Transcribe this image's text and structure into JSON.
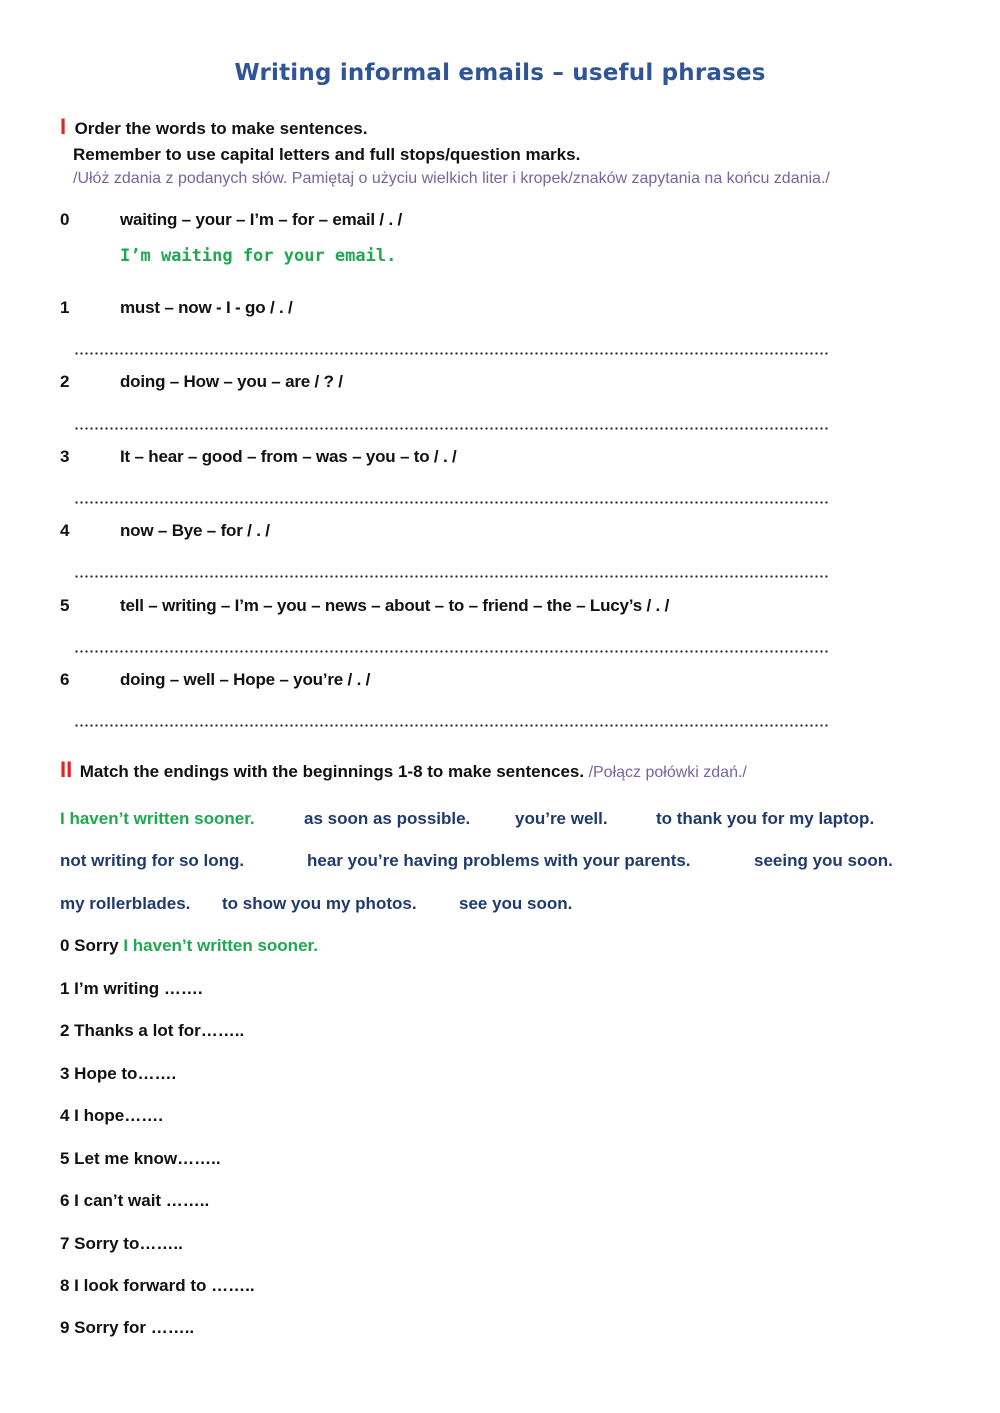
{
  "title": "Writing informal emails – useful phrases",
  "colors": {
    "title": "#2f5597",
    "section_number": "#e8211c",
    "polish_text": "#7a63a0",
    "answer_green": "#1fa84f",
    "ending_blue": "#1f3a6e"
  },
  "section1": {
    "number": "I",
    "instruction_line1": "Order the words to make sentences.",
    "instruction_line2": "Remember to use capital letters and full stops/question marks.",
    "polish": "/Ułóż zdania z podanych słów. Pamiętaj o użyciu wielkich liter i kropek/znaków zapytania na końcu zdania./",
    "items": [
      {
        "num": "0",
        "words": "waiting – your – I’m – for – email  / . /",
        "answer": "I’m waiting for your email."
      },
      {
        "num": "1",
        "words": "must – now - I - go / . /"
      },
      {
        "num": "2",
        "words": "doing – How – you – are  / ? /"
      },
      {
        "num": "3",
        "words": "It – hear – good – from – was – you – to / . /"
      },
      {
        "num": "4",
        "words": "now – Bye – for  / . /"
      },
      {
        "num": "5",
        "words": "tell – writing – I’m – you – news – about – to – friend – the – Lucy’s  / . /"
      },
      {
        "num": "6",
        "words": "doing – well – Hope – you’re  / . /"
      }
    ]
  },
  "section2": {
    "number": "II",
    "instruction": "Match the endings with the beginnings 1-8 to make sentences.",
    "polish": "/Połącz połówki zdań./",
    "endings_row1": [
      "I haven’t written sooner.",
      "as soon as possible.",
      "you’re well.",
      "to thank you for my laptop."
    ],
    "endings_row2": [
      "not writing for so long.",
      "hear you’re having problems with your parents.",
      "seeing you soon."
    ],
    "endings_row3": [
      "my rollerblades.",
      "to show you my photos.",
      "see you soon."
    ],
    "example_begin": "0 Sorry",
    "example_answer": "I haven’t written sooner.",
    "beginnings": [
      "1 I’m writing …….",
      "2 Thanks a lot for……..",
      "3 Hope to…….",
      "4 I hope…….",
      "5 Let me know……..",
      "6 I can’t wait ……..",
      "7 Sorry to……..",
      "8 I look forward to ……..",
      "9 Sorry for …….."
    ]
  }
}
